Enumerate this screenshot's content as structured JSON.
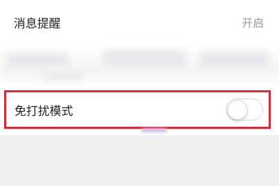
{
  "settings": {
    "message_reminder": {
      "label": "消息提醒",
      "value": "开启"
    },
    "do_not_disturb": {
      "label": "免打扰模式",
      "enabled": false
    }
  },
  "highlight_color": "#e0262b"
}
